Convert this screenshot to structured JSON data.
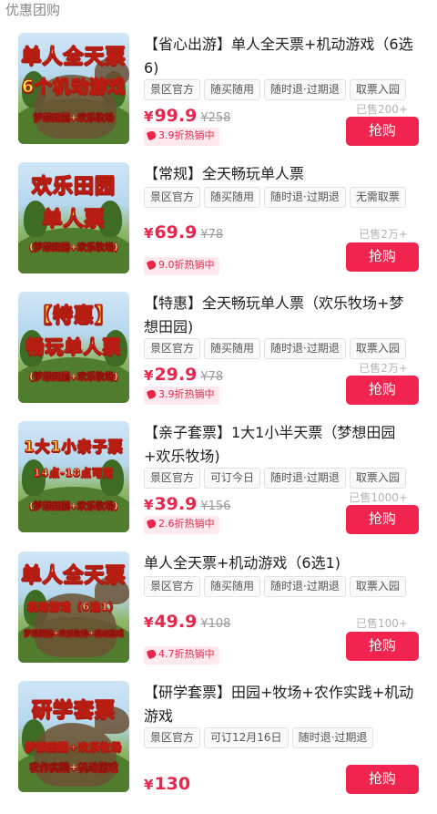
{
  "section": {
    "title": "优惠团购"
  },
  "deals": [
    {
      "thumb_lines": [
        "单人全天票",
        "6个机动游戏",
        "梦想田园+欢乐牧场"
      ],
      "title": "【省心出游】单人全天票+机动游戏（6选6)",
      "tags": [
        "景区官方",
        "随买随用",
        "随时退·过期退",
        "取票入园"
      ],
      "currency": "¥",
      "price": "99.9",
      "original_price": "¥258",
      "hot_label": "3.9折热销中",
      "sold": "已售200+",
      "buy_label": "抢购"
    },
    {
      "thumb_lines": [
        "欢乐田园",
        "单人票",
        "(梦想田园+欢乐牧场)"
      ],
      "title": "【常规】全天畅玩单人票",
      "tags": [
        "景区官方",
        "随买随用",
        "随时退·过期退",
        "无需取票"
      ],
      "currency": "¥",
      "price": "69.9",
      "original_price": "¥78",
      "hot_label": "9.0折热销中",
      "sold": "已售2万+",
      "buy_label": "抢购"
    },
    {
      "thumb_lines": [
        "【特惠】",
        "畅玩单人票",
        "(梦想田园+欢乐牧场)"
      ],
      "title": "【特惠】全天畅玩单人票（欢乐牧场+梦想田园)",
      "tags": [
        "景区官方",
        "随买随用",
        "随时退·过期退",
        "取票入园"
      ],
      "currency": "¥",
      "price": "29.9",
      "original_price": "¥78",
      "hot_label": "3.9折热销中",
      "sold": "已售2万+",
      "buy_label": "抢购"
    },
    {
      "thumb_lines": [
        "1大1小亲子票",
        "14点-18点可用",
        "(梦想田园+欢乐牧场)"
      ],
      "title": "【亲子套票】1大1小半天票（梦想田园+欢乐牧场)",
      "tags": [
        "景区官方",
        "可订今日",
        "随时退·过期退",
        "取票入园"
      ],
      "currency": "¥",
      "price": "39.9",
      "original_price": "¥156",
      "hot_label": "2.6折热销中",
      "sold": "已售1000+",
      "buy_label": "抢购"
    },
    {
      "thumb_lines": [
        "单人全天票",
        "机动游戏（6选1）",
        "梦想田园+欢乐牧场+机动游戏"
      ],
      "title": "单人全天票+机动游戏（6选1)",
      "tags": [
        "景区官方",
        "随买随用",
        "随时退·过期退",
        "取票入园"
      ],
      "currency": "¥",
      "price": "49.9",
      "original_price": "¥108",
      "hot_label": "4.7折热销中",
      "sold": "已售100+",
      "buy_label": "抢购"
    },
    {
      "thumb_lines": [
        "研学套票",
        "梦想田园+欢乐牧场",
        "农作实践+机动游戏"
      ],
      "title": "【研学套票】田园+牧场+农作实践+机动游戏",
      "tags": [
        "景区官方",
        "可订12月16日",
        "随时退·过期退"
      ],
      "currency": "¥",
      "price": "130",
      "original_price": "",
      "hot_label": "",
      "sold": "",
      "buy_label": "抢购"
    }
  ]
}
